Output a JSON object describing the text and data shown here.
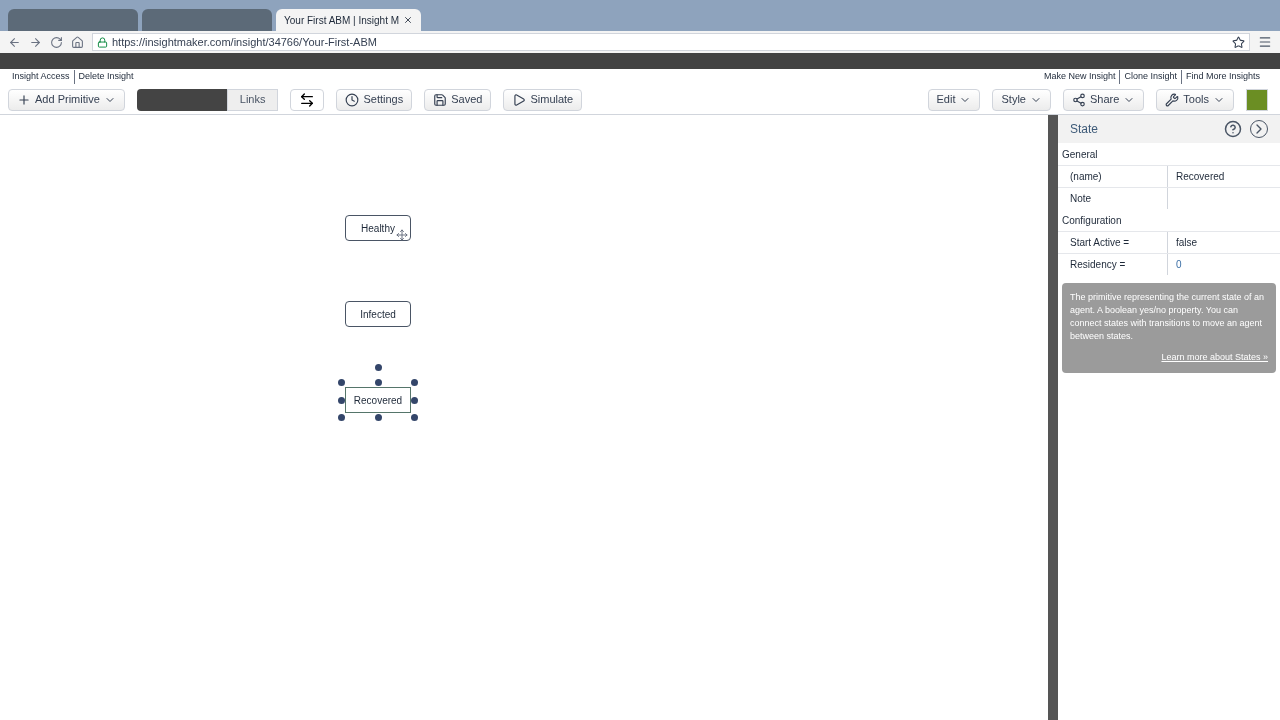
{
  "browser": {
    "tabs": [
      {
        "selected": false
      },
      {
        "selected": false
      },
      {
        "title": "Your First ABM | Insight M",
        "selected": true
      }
    ],
    "url": "https://insightmaker.com/insight/34766/Your-First-ABM"
  },
  "top_links": {
    "left": [
      "Insight Access",
      "Delete Insight"
    ],
    "right": [
      "Make New Insight",
      "Clone Insight",
      "Find More Insights"
    ]
  },
  "toolbar": {
    "left": [
      {
        "kind": "dropdown",
        "label": "Add Primitive"
      },
      {
        "kind": "links",
        "label": "Links"
      },
      {
        "kind": "swap"
      },
      {
        "kind": "button",
        "label": "Settings"
      },
      {
        "kind": "button",
        "label": "Saved"
      },
      {
        "kind": "button",
        "label": "Simulate"
      }
    ],
    "right": [
      {
        "kind": "dropdown",
        "label": "Edit"
      },
      {
        "kind": "dropdown",
        "label": "Style"
      },
      {
        "kind": "dropdown",
        "label": "Share"
      },
      {
        "kind": "dropdown",
        "label": "Tools"
      }
    ]
  },
  "canvas": {
    "states": [
      {
        "label": "Healthy",
        "selected": false,
        "hovered": true
      },
      {
        "label": "Infected",
        "selected": false,
        "hovered": false
      },
      {
        "label": "Recovered",
        "selected": true,
        "hovered": false
      }
    ]
  },
  "panel": {
    "title": "State",
    "sections": [
      {
        "title": "General",
        "rows": [
          {
            "name": "(name)",
            "value": "Recovered"
          },
          {
            "name": "Note"
          }
        ]
      },
      {
        "title": "Configuration",
        "rows": [
          {
            "name": "Start Active =",
            "value": "false"
          },
          {
            "name": "Residency =",
            "value": "0",
            "kind": "number"
          }
        ]
      }
    ],
    "help": {
      "text": "The primitive representing the current state of an agent. A boolean yes/no property. You can connect states with transitions to move an agent between states.",
      "link": "Learn more about States »"
    }
  }
}
